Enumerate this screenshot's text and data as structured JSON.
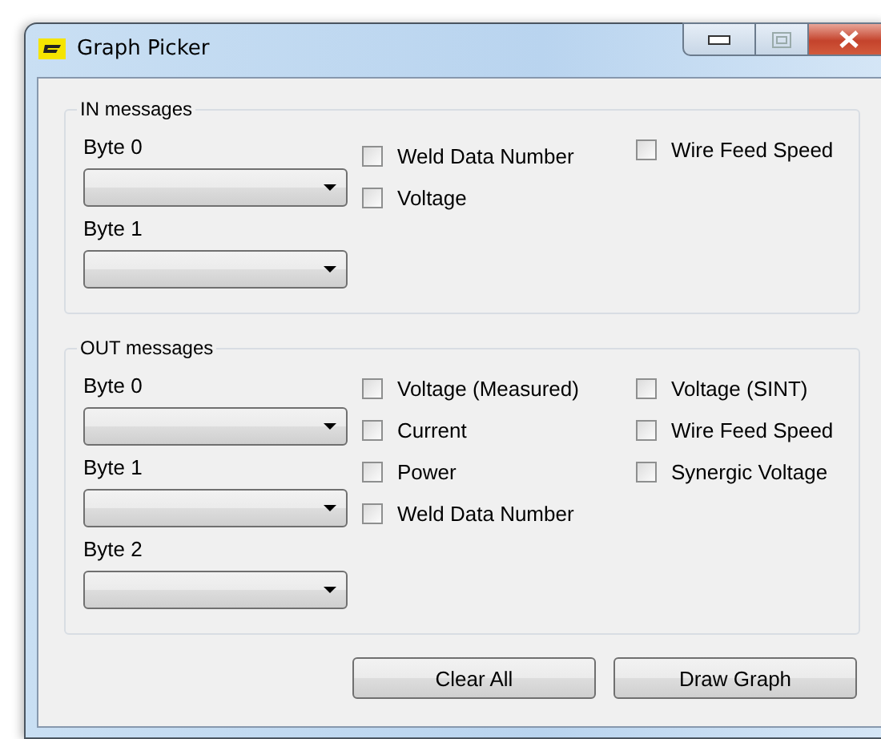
{
  "window": {
    "title": "Graph Picker"
  },
  "groups": [
    {
      "title": "IN messages",
      "bytes": [
        {
          "label": "Byte 0"
        },
        {
          "label": "Byte 1"
        }
      ],
      "columns": [
        [
          {
            "label": "Weld Data Number",
            "checked": false
          },
          {
            "label": "Voltage",
            "checked": false
          }
        ],
        [
          {
            "label": "Wire Feed Speed",
            "checked": false
          }
        ]
      ]
    },
    {
      "title": "OUT messages",
      "bytes": [
        {
          "label": "Byte 0"
        },
        {
          "label": "Byte 1"
        },
        {
          "label": "Byte 2"
        }
      ],
      "columns": [
        [
          {
            "label": "Voltage (Measured)",
            "checked": false
          },
          {
            "label": "Current",
            "checked": false
          },
          {
            "label": "Power",
            "checked": false
          },
          {
            "label": "Weld Data Number",
            "checked": false
          }
        ],
        [
          {
            "label": "Voltage (SINT)",
            "checked": false
          },
          {
            "label": "Wire Feed Speed",
            "checked": false
          },
          {
            "label": "Synergic Voltage",
            "checked": false
          }
        ]
      ]
    }
  ],
  "buttons": [
    "Clear All",
    "Draw Graph"
  ]
}
